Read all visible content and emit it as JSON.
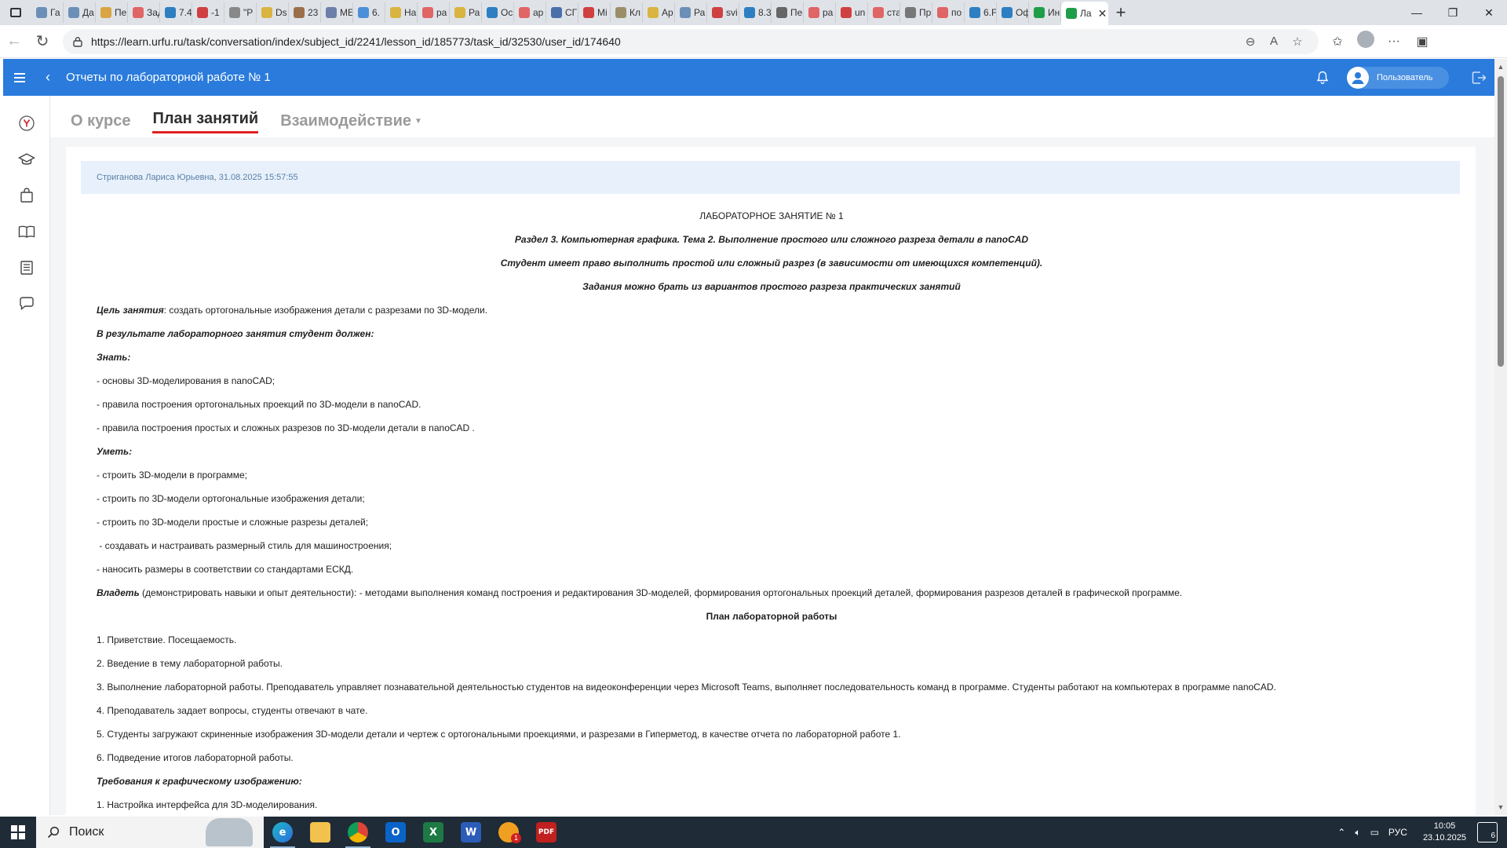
{
  "browser": {
    "tabs": [
      {
        "label": "Га",
        "color": "#6c8fb8"
      },
      {
        "label": "Да",
        "color": "#6c8fb8"
      },
      {
        "label": "Пе",
        "color": "#d9a441"
      },
      {
        "label": "Зад",
        "color": "#e06565"
      },
      {
        "label": "7.4",
        "color": "#2d7fc1"
      },
      {
        "label": "-1",
        "color": "#d04040"
      },
      {
        "label": "\"Р",
        "color": "#888888"
      },
      {
        "label": "Ds",
        "color": "#d9b441"
      },
      {
        "label": "23",
        "color": "#9b6f4a"
      },
      {
        "label": "МЕ",
        "color": "#6c7fa8"
      },
      {
        "label": "6.",
        "color": "#4a8fd8"
      },
      {
        "label": "На",
        "color": "#d9b441"
      },
      {
        "label": "ра",
        "color": "#e06565"
      },
      {
        "label": "Ра",
        "color": "#d9b441"
      },
      {
        "label": "Ос",
        "color": "#2d7fc1"
      },
      {
        "label": "ар",
        "color": "#e06565"
      },
      {
        "label": "СГ",
        "color": "#4a6fa8"
      },
      {
        "label": "Mi",
        "color": "#d04040"
      },
      {
        "label": "Кл",
        "color": "#9b8f6a"
      },
      {
        "label": "Ар",
        "color": "#d9b441"
      },
      {
        "label": "Ра",
        "color": "#6c8fb8"
      },
      {
        "label": "svi",
        "color": "#d04040"
      },
      {
        "label": "8.3",
        "color": "#2d7fc1"
      },
      {
        "label": "Пе",
        "color": "#666666"
      },
      {
        "label": "ра",
        "color": "#e06565"
      },
      {
        "label": "un",
        "color": "#d04040"
      },
      {
        "label": "ста",
        "color": "#e06565"
      },
      {
        "label": "Пр",
        "color": "#777777"
      },
      {
        "label": "по",
        "color": "#e06565"
      },
      {
        "label": "6.F",
        "color": "#2d7fc1"
      },
      {
        "label": "Оф",
        "color": "#2d7fc1"
      },
      {
        "label": "Ин",
        "color": "#1f9e4a"
      },
      {
        "label": "Ла",
        "color": "#1f9e4a"
      }
    ],
    "url": "https://learn.urfu.ru/task/conversation/index/subject_id/2241/lesson_id/185773/task_id/32530/user_id/174640"
  },
  "header": {
    "title": "Отчеты по лабораторной работе № 1",
    "user_label": "Пользователь",
    "accent": "#2a7bdc"
  },
  "tabs": [
    {
      "label": "О курсе"
    },
    {
      "label": "План занятий"
    },
    {
      "label": "Взаимодействие"
    }
  ],
  "message": {
    "author_line": "Стриганова Лариса Юрьевна, 31.08.2025 15:57:55",
    "title": "ЛАБОРАТОРНОЕ ЗАНЯТИЕ № 1",
    "section": "Раздел 3. Компьютерная графика. Тема 2. Выполнение простого или сложного разреза детали в nanoCAD",
    "note1": "Студент имеет право выполнить простой или сложный разрез (в зависимости от имеющихся компетенций).",
    "note2": "Задания можно брать из вариантов простого разреза практических занятий",
    "goal_label": "Цель занятия",
    "goal_text": ": создать ортогональные изображения детали с разрезами по 3D-модели.",
    "result_label": "В результате лабораторного занятия студент должен:",
    "know_label": "Знать:",
    "know": [
      "- основы 3D-моделирования в nanoCAD;",
      "- правила построения ортогональных проекций по 3D-модели в nanoCAD.",
      "- правила построения простых и сложных разрезов по 3D-модели детали в nanoCAD ."
    ],
    "can_label": "Уметь:",
    "can": [
      "- строить 3D-модели в программе;",
      "- строить по 3D-модели ортогональные изображения детали;",
      "- строить по 3D-модели простые и сложные разрезы деталей;",
      " - создавать и настраивать размерный стиль для машиностроения;",
      "- наносить размеры в соответствии со стандартами ЕСКД."
    ],
    "own_label": "Владеть",
    "own_text": " (демонстрировать навыки и опыт деятельности): - методами выполнения команд построения и редактирования 3D-моделей, формирования ортогональных проекций деталей, формирования разрезов деталей в графической программе.",
    "plan_title": "План лабораторной работы",
    "plan": [
      "1. Приветствие. Посещаемость.",
      "2. Введение в тему лабораторной работы.",
      "3. Выполнение лабораторной работы. Преподаватель управляет познавательной деятельностью студентов на видеоконференции через Microsoft Teams, выполняет последовательность команд в программе. Студенты работают на компьютерах в программе nanoCAD.",
      "4. Преподаватель задает вопросы, студенты отвечают в чате.",
      "5. Студенты загружают скриненные изображения 3D-модели детали и чертеж с ортогональными проекциями, и разрезами в Гиперметод, в качестве отчета по лабораторной работе 1.",
      "6. Подведение итогов лабораторной работы."
    ],
    "req_label": "Требования к графическому изображению:",
    "req": [
      "1. Настройка интерфейса для 3D-моделирования."
    ]
  },
  "taskbar": {
    "search_placeholder": "Поиск",
    "lang": "РУС",
    "time": "10:05",
    "date": "23.10.2025",
    "notif_count": "6",
    "badge_count": "1"
  }
}
